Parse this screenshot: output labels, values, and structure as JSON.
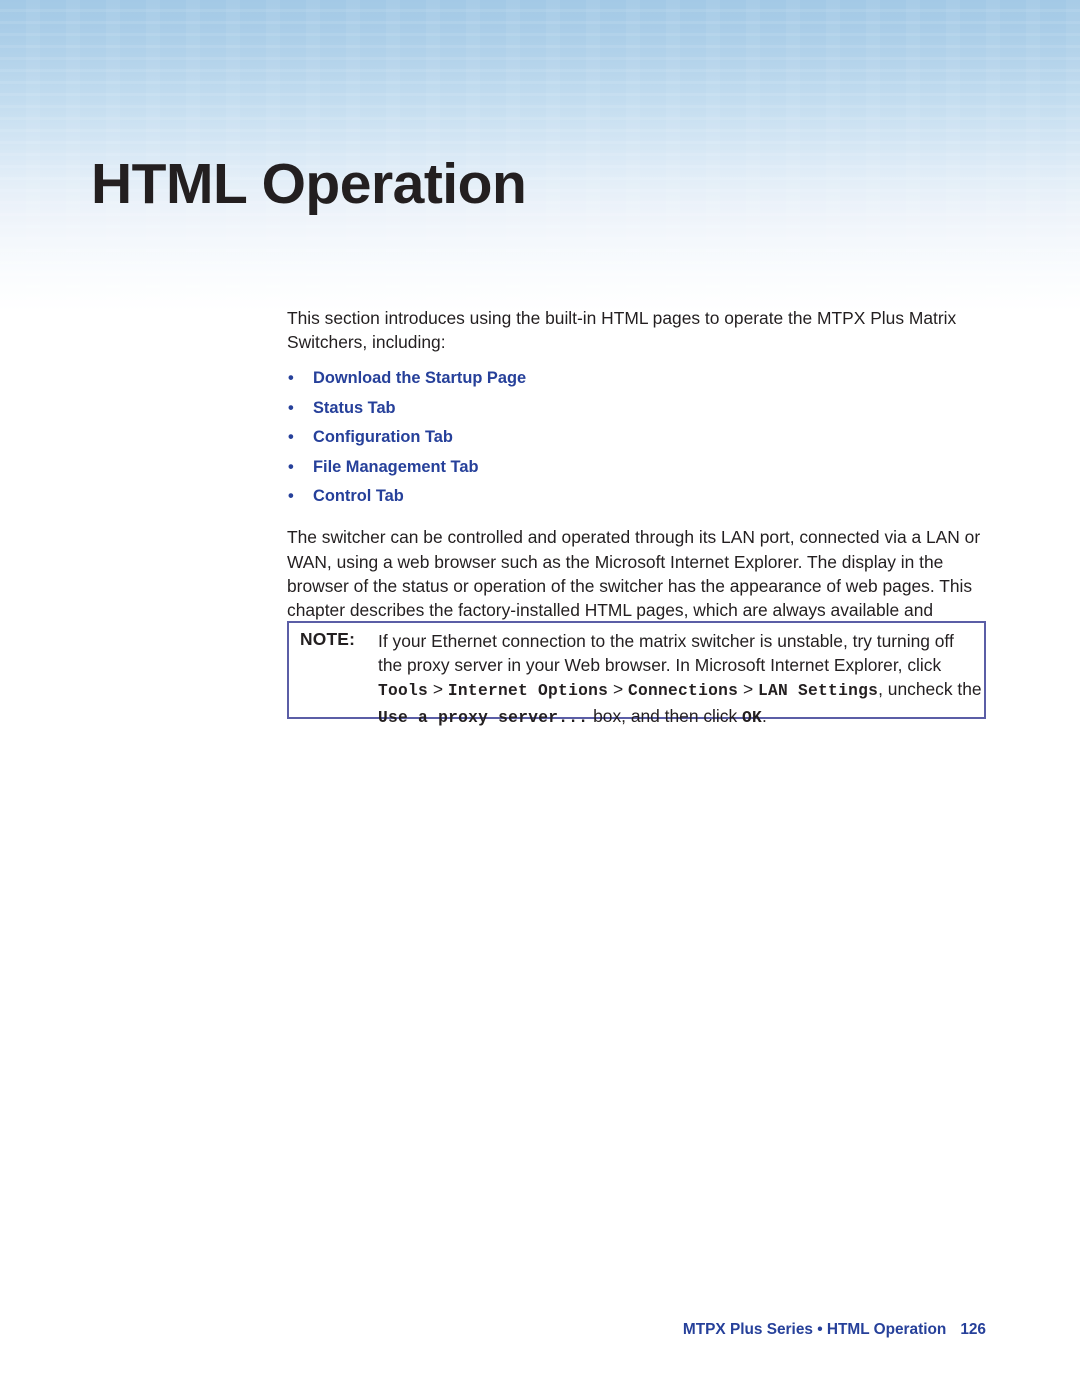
{
  "header": {
    "title": "HTML Operation",
    "gradient_top_color": "#a3c9e6",
    "gradient_bottom_color": "#ffffff",
    "title_color": "#231f20"
  },
  "accent_color": "#26409a",
  "note_border_color": "#5b5ea6",
  "main": {
    "intro_paragraph": "This section introduces using the built-in HTML pages to operate the MTPX Plus Matrix Switchers, including:",
    "bullets": [
      {
        "marker": "•",
        "label": "Download the Startup Page"
      },
      {
        "marker": "•",
        "label": "Status Tab"
      },
      {
        "marker": "•",
        "label": "Configuration Tab"
      },
      {
        "marker": "•",
        "label": "File Management Tab"
      },
      {
        "marker": "•",
        "label": "Control Tab"
      }
    ],
    "switcher_paragraph": "The switcher can be controlled and operated through its LAN port, connected via a LAN or WAN, using a web browser such as the Microsoft Internet Explorer. The display in the browser of the status or operation of the switcher has the appearance of web pages. This chapter describes the factory-installed HTML pages, which are always available and cannot be erased or overwritten."
  },
  "note": {
    "label": "NOTE:",
    "line1": "If your Ethernet connection to the matrix switcher is unstable, try turning off",
    "line2": "the proxy server in your Web browser. In Microsoft Internet Explorer, click",
    "path_tools": "Tools",
    "sep1": " > ",
    "path_internet_options": "Internet Options",
    "sep2": " > ",
    "path_connections": "Connections",
    "sep3": " > ",
    "path_lan_settings": "LAN Settings",
    "line3_tail": ", uncheck the",
    "path_proxy_checkbox": "Use a proxy server...",
    "line4_mid": " box, and then click ",
    "path_ok": "OK",
    "line4_end": "."
  },
  "footer": {
    "text": "MTPX Plus Series • HTML Operation",
    "page_number": "126"
  }
}
